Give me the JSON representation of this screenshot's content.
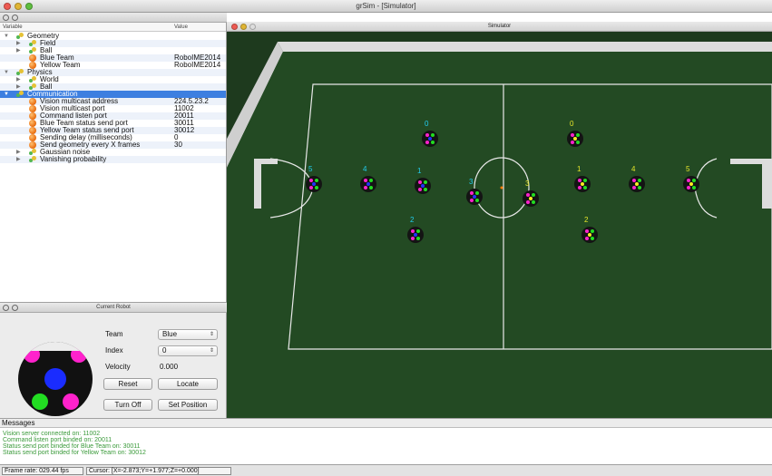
{
  "window": {
    "title": "grSim - [Simulator]"
  },
  "tree": {
    "col_variable": "Variable",
    "col_value": "Value",
    "rows": [
      {
        "label": "Geometry",
        "value": "",
        "depth": 0,
        "icon": "folder-icon",
        "arrow": "▼"
      },
      {
        "label": "Field",
        "value": "",
        "depth": 1,
        "icon": "folder-icon",
        "arrow": "▶"
      },
      {
        "label": "Ball",
        "value": "",
        "depth": 1,
        "icon": "folder-icon",
        "arrow": "▶"
      },
      {
        "label": "Blue Team",
        "value": "RoboIME2014",
        "depth": 1,
        "icon": "ball-icon",
        "arrow": ""
      },
      {
        "label": "Yellow Team",
        "value": "RoboIME2014",
        "depth": 1,
        "icon": "ball-icon",
        "arrow": ""
      },
      {
        "label": "Physics",
        "value": "",
        "depth": 0,
        "icon": "folder-icon",
        "arrow": "▼"
      },
      {
        "label": "World",
        "value": "",
        "depth": 1,
        "icon": "folder-icon",
        "arrow": "▶"
      },
      {
        "label": "Ball",
        "value": "",
        "depth": 1,
        "icon": "folder-icon",
        "arrow": "▶"
      },
      {
        "label": "Communication",
        "value": "",
        "depth": 0,
        "icon": "folder-icon",
        "arrow": "▼",
        "selected": true
      },
      {
        "label": "Vision multicast address",
        "value": "224.5.23.2",
        "depth": 1,
        "icon": "ball-icon",
        "arrow": ""
      },
      {
        "label": "Vision multicast port",
        "value": "11002",
        "depth": 1,
        "icon": "ball-icon",
        "arrow": ""
      },
      {
        "label": "Command listen port",
        "value": "20011",
        "depth": 1,
        "icon": "ball-icon",
        "arrow": ""
      },
      {
        "label": "Blue Team status send port",
        "value": "30011",
        "depth": 1,
        "icon": "ball-icon",
        "arrow": ""
      },
      {
        "label": "Yellow Team status send port",
        "value": "30012",
        "depth": 1,
        "icon": "ball-icon",
        "arrow": ""
      },
      {
        "label": "Sending delay (milliseconds)",
        "value": "0",
        "depth": 1,
        "icon": "ball-icon",
        "arrow": ""
      },
      {
        "label": "Send geometry every X frames",
        "value": "30",
        "depth": 1,
        "icon": "ball-icon",
        "arrow": ""
      },
      {
        "label": "Gaussian noise",
        "value": "",
        "depth": 1,
        "icon": "folder-icon",
        "arrow": "▶"
      },
      {
        "label": "Vanishing probability",
        "value": "",
        "depth": 1,
        "icon": "folder-icon",
        "arrow": "▶"
      }
    ]
  },
  "current_robot": {
    "title": "Current Robot",
    "team_label": "Team",
    "team_value": "Blue",
    "index_label": "Index",
    "index_value": "0",
    "velocity_label": "Velocity",
    "velocity_value": "0.000",
    "reset_label": "Reset",
    "locate_label": "Locate",
    "turn_off_label": "Turn Off",
    "set_position_label": "Set Position",
    "colors": {
      "center": "#1a2cff",
      "magenta": "#ff22cc",
      "green": "#22dd22",
      "body": "#111111"
    }
  },
  "simulator": {
    "title": "Simulator",
    "field_color": "#234a23",
    "wall_color": "#d8d8d8",
    "blue_labels": [
      "0",
      "1",
      "2",
      "3",
      "4",
      "5"
    ],
    "yellow_labels": [
      "0",
      "1",
      "2",
      "3",
      "4",
      "5"
    ],
    "blue_label_color": "#22ccee",
    "yellow_label_color": "#e5e52a"
  },
  "messages": {
    "header": "Messages",
    "lines": [
      "Vision server connected on: 11002",
      "Command listen port binded on: 20011",
      "Status send port binded for Blue Team on: 30011",
      "Status send port binded for Yellow Team on: 30012"
    ]
  },
  "status": {
    "frame_rate": "Frame rate: 029.44 fps",
    "cursor": "Cursor: [X=-2.873;Y=+1.977;Z=+0.000]"
  }
}
